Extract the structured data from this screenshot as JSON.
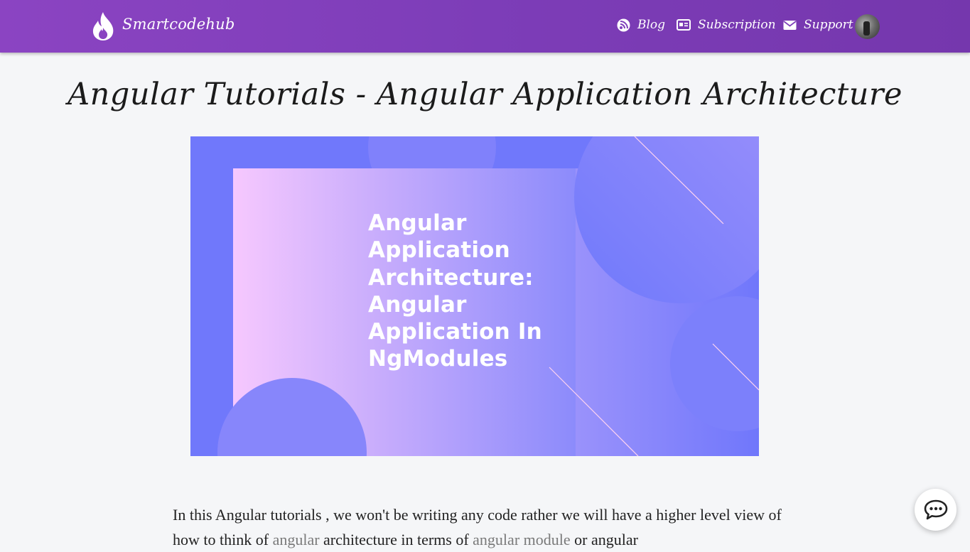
{
  "navbar": {
    "brand": "Smartcodehub",
    "links": [
      {
        "label": "Blog",
        "icon": "rss-icon"
      },
      {
        "label": "Subscription",
        "icon": "id-card-icon"
      },
      {
        "label": "Support",
        "icon": "envelope-icon"
      }
    ]
  },
  "page": {
    "title": "Angular Tutorials - Angular Application Architecture"
  },
  "hero": {
    "lines": [
      "Angular",
      "Application",
      "Architecture:",
      "Angular",
      "Application In",
      "NgModules"
    ]
  },
  "content": {
    "text1": "In this Angular tutorials , we won't be writing any code rather we will have a higher level view of how to think of ",
    "link1": "angular",
    "text2": " architecture in terms of ",
    "link2": "angular module",
    "text3": " or angular"
  },
  "colors": {
    "navbar": "#7d3db8",
    "hero_bg": "#7077fb",
    "link": "#7a7a7a"
  }
}
